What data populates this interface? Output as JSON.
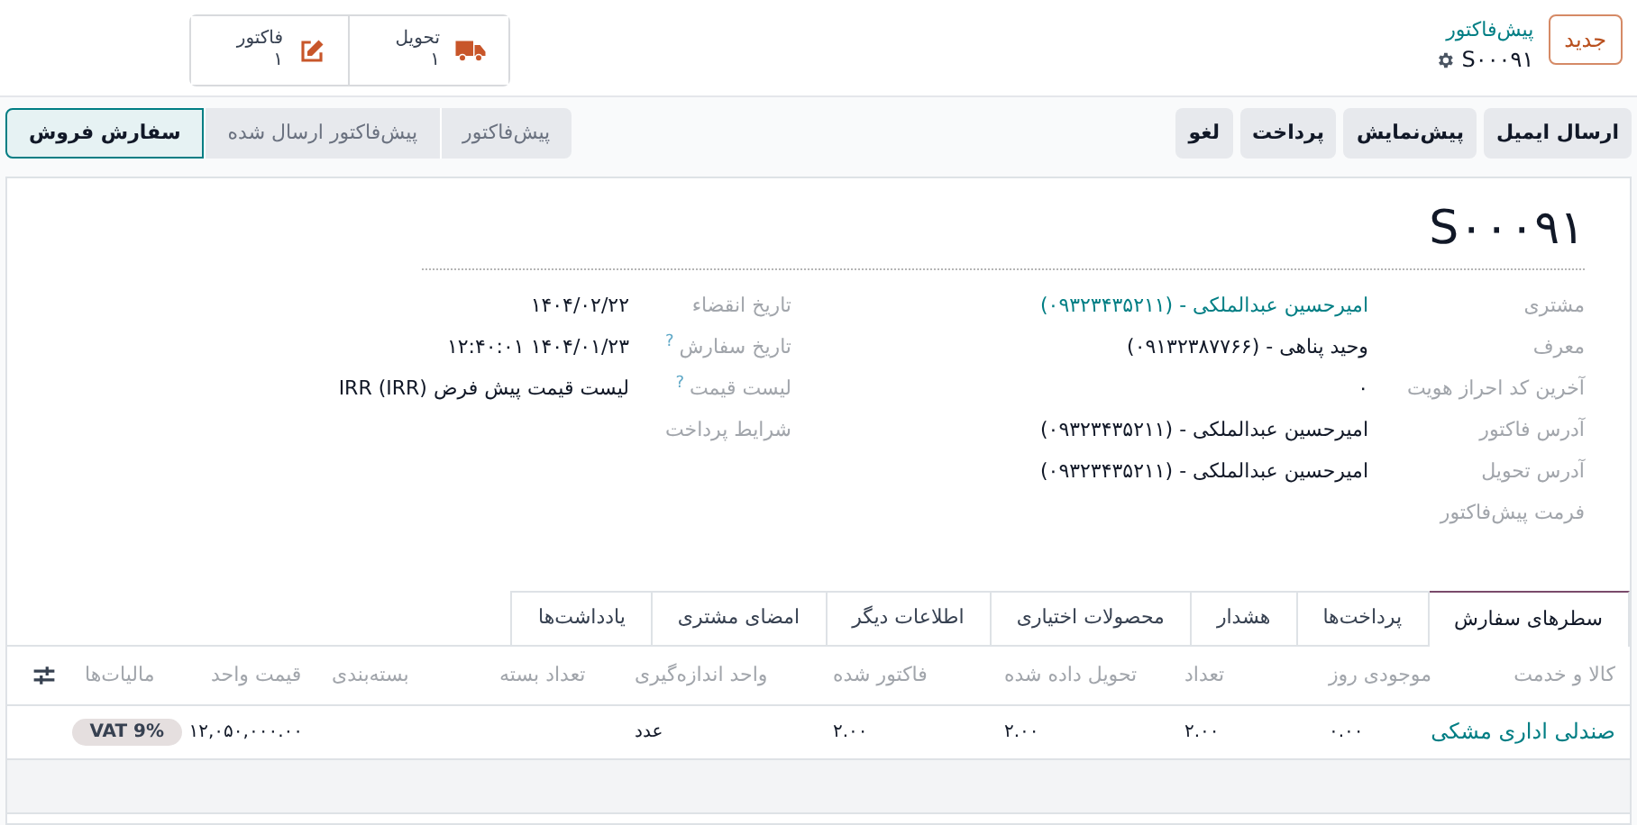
{
  "new_button": "جدید",
  "breadcrumb": {
    "parent": "پیش‌فاکتور",
    "record": "S۰۰۰۹۱"
  },
  "smart_buttons": [
    {
      "kind": "delivery",
      "label": "تحویل",
      "count": "۱"
    },
    {
      "kind": "invoice",
      "label": "فاکتور",
      "count": "۱"
    }
  ],
  "actions": [
    "ارسال ایمیل",
    "پیش‌نمایش",
    "پرداخت",
    "لغو"
  ],
  "stages": [
    {
      "label": "پیش‌فاکتور",
      "selected": false
    },
    {
      "label": "پیش‌فاکتور ارسال شده",
      "selected": false
    },
    {
      "label": "سفارش فروش",
      "selected": true
    }
  ],
  "title": "S۰۰۰۹۱",
  "fields_right": [
    {
      "label": "مشتری",
      "value": "امیرحسین عبدالملکی - (۰۹۳۲۳۴۳۵۲۱۱)",
      "link": true
    },
    {
      "label": "معرف",
      "value": "وحید پناهی - (۰۹۱۳۲۳۸۷۷۶۶)",
      "link": false
    },
    {
      "label": "آخرین کد احراز هویت",
      "value": "۰",
      "link": false
    },
    {
      "label": "آدرس فاکتور",
      "value": "امیرحسین عبدالملکی - (۰۹۳۲۳۴۳۵۲۱۱)",
      "link": false
    },
    {
      "label": "آدرس تحویل",
      "value": "امیرحسین عبدالملکی - (۰۹۳۲۳۴۳۵۲۱۱)",
      "link": false
    },
    {
      "label": "فرمت پیش‌فاکتور"
    }
  ],
  "fields_left": [
    {
      "label": "تاریخ انقضاء",
      "value": "۱۴۰۴/۰۲/۲۲"
    },
    {
      "label": "تاریخ سفارش",
      "help": "?",
      "value": "۱۴۰۴/۰۱/۲۳ ۱۲:۴۰:۰۱"
    },
    {
      "label": "لیست قیمت",
      "help": "?",
      "value": "لیست قیمت پیش فرض IRR (IRR)"
    },
    {
      "label": "شرایط پرداخت"
    }
  ],
  "tabs": [
    {
      "label": "سطرهای سفارش",
      "selected": true
    },
    {
      "label": "پرداخت‌ها",
      "selected": false
    },
    {
      "label": "هشدار",
      "selected": false
    },
    {
      "label": "محصولات اختیاری",
      "selected": false
    },
    {
      "label": "اطلاعات دیگر",
      "selected": false
    },
    {
      "label": "امضای مشتری",
      "selected": false
    },
    {
      "label": "یادداشت‌ها",
      "selected": false
    }
  ],
  "table": {
    "columns": [
      "کالا و خدمت",
      "موجودی روز",
      "تعداد",
      "تحویل داده شده",
      "فاکتور شده",
      "واحد اندازه‌گیری",
      "تعداد بسته",
      "بسته‌بندی",
      "قیمت واحد",
      "مالیات‌ها"
    ],
    "rows": [
      {
        "product": "صندلی اداری مشکی",
        "on_hand": "۰.۰۰",
        "quantity": "۲.۰۰",
        "delivered": "۲.۰۰",
        "invoiced": "۲.۰۰",
        "uom": "عدد",
        "price": "۱۲,۰۵۰,۰۰۰.۰۰",
        "taxes": [
          "VAT 9%"
        ]
      }
    ]
  }
}
